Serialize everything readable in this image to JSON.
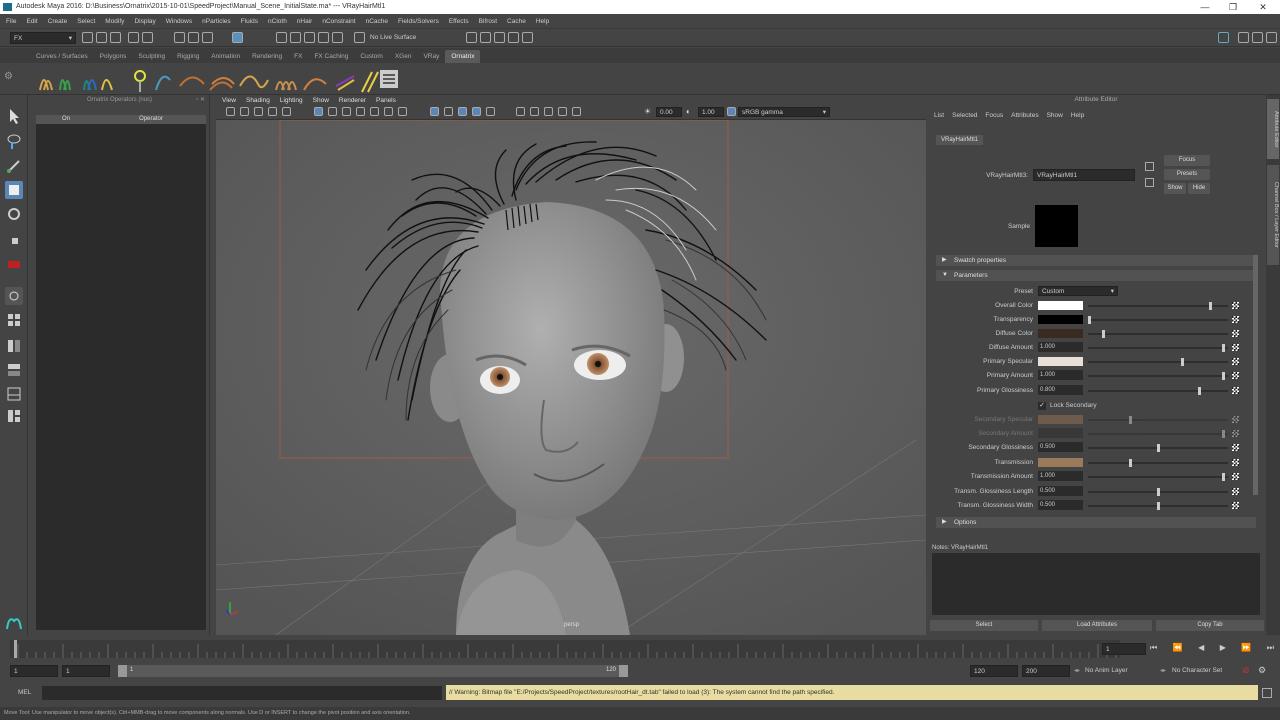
{
  "window": {
    "title": "Autodesk Maya 2016: D:\\Business\\Ornatrix\\2015-10-01\\SpeedProject\\Manual_Scene_InitialState.ma*  ---  VRayHairMtl1",
    "minimize": "—",
    "maximize": "❐",
    "close": "✕"
  },
  "menubar": [
    "File",
    "Edit",
    "Create",
    "Select",
    "Modify",
    "Display",
    "Windows",
    "nParticles",
    "Fluids",
    "nCloth",
    "nHair",
    "nConstraint",
    "nCache",
    "Fields/Solvers",
    "Effects",
    "Bifrost",
    "Cache",
    "Help"
  ],
  "statusline": {
    "mode": "FX",
    "live_surface": "No Live Surface"
  },
  "shelf_tabs": [
    "Curves / Surfaces",
    "Polygons",
    "Sculpting",
    "Rigging",
    "Animation",
    "Rendering",
    "FX",
    "FX Caching",
    "Custom",
    "XGen",
    "VRay",
    "Ornatrix"
  ],
  "active_shelf_tab": "Ornatrix",
  "outliner": {
    "title": "Ornatrix Operators (nus)",
    "col_on": "On",
    "col_operator": "Operator"
  },
  "viewport": {
    "menu": [
      "View",
      "Shading",
      "Lighting",
      "Show",
      "Renderer",
      "Panels"
    ],
    "exposure": "0.00",
    "gamma": "1.00",
    "color_space": "sRGB gamma",
    "camera_label": "persp"
  },
  "attribute_editor": {
    "title": "Attribute Editor",
    "menu": [
      "List",
      "Selected",
      "Focus",
      "Attributes",
      "Show",
      "Help"
    ],
    "tab": "VRayHairMtl1",
    "node_label": "VRayHairMtl3:",
    "node_value": "VRayHairMtl1",
    "focus": "Focus",
    "presets": "Presets",
    "show": "Show",
    "hide": "Hide",
    "sample_label": "Sample",
    "section_swatch": "Swatch properties",
    "section_params": "Parameters",
    "section_options": "Options",
    "preset_label": "Preset",
    "preset_value": "Custom",
    "attrs": [
      {
        "label": "Overall Color",
        "kind": "color",
        "color": "#ffffff",
        "slider": 0.88
      },
      {
        "label": "Transparency",
        "kind": "color",
        "color": "#000000",
        "slider": 0.0
      },
      {
        "label": "Diffuse Color",
        "kind": "color",
        "color": "#3a2a20",
        "slider": 0.1
      },
      {
        "label": "Diffuse Amount",
        "kind": "num",
        "value": "1.000",
        "slider": 0.98
      },
      {
        "label": "Primary Specular",
        "kind": "color",
        "color": "#e8e0d8",
        "slider": 0.68
      },
      {
        "label": "Primary Amount",
        "kind": "num",
        "value": "1.000",
        "slider": 0.98
      },
      {
        "label": "Primary Glossiness",
        "kind": "num",
        "value": "0.800",
        "slider": 0.8
      },
      {
        "label": "Lock Secondary",
        "kind": "check"
      },
      {
        "label": "Secondary Specular",
        "kind": "color",
        "color": "#8a6a50",
        "slider": 0.3,
        "dim": true
      },
      {
        "label": "Secondary Amount",
        "kind": "num",
        "value": "",
        "slider": 0.98,
        "dim": true
      },
      {
        "label": "Secondary Glossiness",
        "kind": "num",
        "value": "0.500",
        "slider": 0.5
      },
      {
        "label": "Transmission",
        "kind": "color",
        "color": "#9a7a5a",
        "slider": 0.3
      },
      {
        "label": "Transmission Amount",
        "kind": "num",
        "value": "1.000",
        "slider": 0.98
      },
      {
        "label": "Transm. Glossiness Length",
        "kind": "num",
        "value": "0.500",
        "slider": 0.5
      },
      {
        "label": "Transm. Glossiness Width",
        "kind": "num",
        "value": "0.500",
        "slider": 0.5
      }
    ],
    "notes_label": "Notes:  VRayHairMtl1",
    "bottom_buttons": [
      "Select",
      "Load Attributes",
      "Copy Tab"
    ]
  },
  "timeline": {
    "start_frame": "1",
    "current_frame": "1",
    "range_start": "1",
    "range_inner_start": "1",
    "range_inner_end": "120",
    "range_end": "120",
    "anim_end": "200",
    "anim_layer": "No Anim Layer",
    "character_set": "No Character Set"
  },
  "command": {
    "lang": "MEL",
    "warning": "// Warning: Bitmap file \"E:/Projects/SpeedProject/textures/rootHair_dt.tab\" failed to load (3): The system cannot find the path specified.",
    "help": "Move Tool: Use manipulator to move object(s). Ctrl+MMB-drag to move components along normals. Use D or INSERT to change the pivot position and axis orientation."
  },
  "side_tabs": [
    "Attribute Editor",
    "Channel Box / Layer Editor"
  ]
}
